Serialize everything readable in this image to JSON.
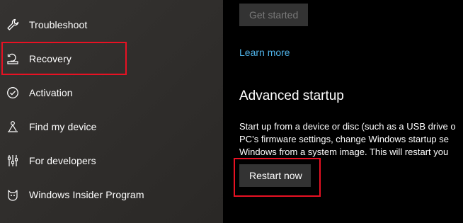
{
  "sidebar": {
    "items": [
      {
        "label": "Troubleshoot",
        "icon": "wrench-icon"
      },
      {
        "label": "Recovery",
        "icon": "recovery-icon"
      },
      {
        "label": "Activation",
        "icon": "check-circle-icon"
      },
      {
        "label": "Find my device",
        "icon": "person-pin-icon"
      },
      {
        "label": "For developers",
        "icon": "developer-tools-icon"
      },
      {
        "label": "Windows Insider Program",
        "icon": "insider-cat-icon"
      }
    ],
    "selected": "Recovery"
  },
  "main": {
    "get_started_label": "Get started",
    "learn_more_label": "Learn more",
    "advanced_startup": {
      "title": "Advanced startup",
      "description_lines": [
        "Start up from a device or disc (such as a USB drive o",
        "PC’s firmware settings, change Windows startup se",
        "Windows from a system image. This will restart you"
      ],
      "restart_label": "Restart now"
    }
  },
  "colors": {
    "highlight": "#e81123",
    "link": "#4fb2e8",
    "button": "#333333"
  }
}
